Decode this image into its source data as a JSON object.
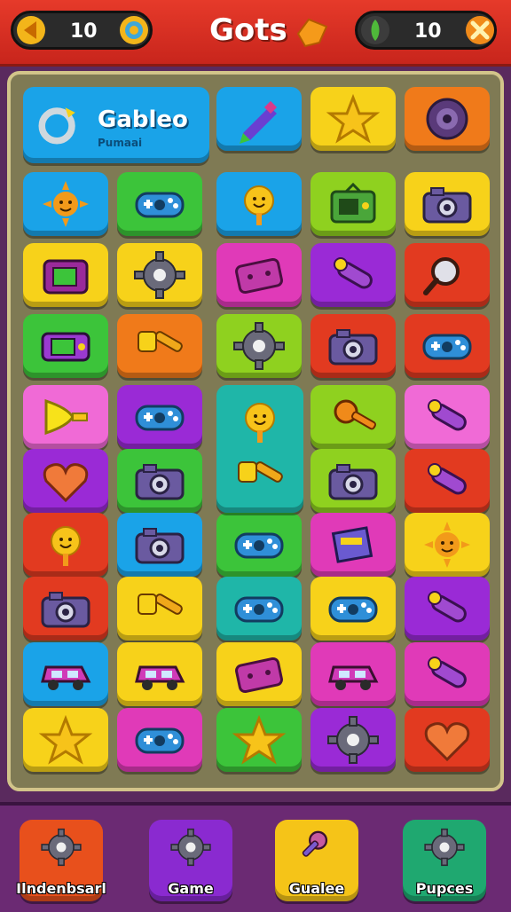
{
  "header": {
    "title": "Gots",
    "left_counter": "10",
    "right_counter": "10",
    "accent": "#e63a2a"
  },
  "banner": {
    "title": "Gableo",
    "subtitle": "Pumaai"
  },
  "colors": {
    "blue": "#1aa3e8",
    "yellow": "#f7d21a",
    "orange": "#f07a1a",
    "green": "#3cc43a",
    "lime": "#8fd11f",
    "pink": "#f06ad6",
    "purple": "#9a2ad6",
    "red": "#e23a20",
    "teal": "#1fb6a8",
    "magenta": "#e03ab8"
  },
  "tiles": [
    {
      "color": "blue",
      "icon": "pencil-icon"
    },
    {
      "color": "yellow",
      "icon": "star-icon"
    },
    {
      "color": "orange",
      "icon": "target-icon"
    },
    {
      "color": "blue",
      "icon": "sun-icon"
    },
    {
      "color": "green",
      "icon": "gamepad-icon"
    },
    {
      "color": "blue",
      "icon": "smiley-icon"
    },
    {
      "color": "lime",
      "icon": "tv-icon"
    },
    {
      "color": "yellow",
      "icon": "camera-icon"
    },
    {
      "color": "yellow",
      "icon": "radio-icon"
    },
    {
      "color": "yellow",
      "icon": "gear-icon"
    },
    {
      "color": "magenta",
      "icon": "handheld-icon"
    },
    {
      "color": "purple",
      "icon": "tube-icon"
    },
    {
      "color": "red",
      "icon": "magnifier-icon"
    },
    {
      "color": "green",
      "icon": "console-icon"
    },
    {
      "color": "orange",
      "icon": "hammer-icon"
    },
    {
      "color": "lime",
      "icon": "gear-icon"
    },
    {
      "color": "red",
      "icon": "camera-icon"
    },
    {
      "color": "red",
      "icon": "gamepad-icon"
    },
    {
      "color": "pink",
      "icon": "horn-icon"
    },
    {
      "color": "purple",
      "icon": "gamepad-icon"
    },
    {
      "color": "lime",
      "icon": "key-icon"
    },
    {
      "color": "pink",
      "icon": "tube-icon"
    },
    {
      "color": "purple",
      "icon": "heart-icon"
    },
    {
      "color": "green",
      "icon": "camera-icon"
    },
    {
      "color": "lime",
      "icon": "camera-icon"
    },
    {
      "color": "red",
      "icon": "tube-icon"
    },
    {
      "color": "red",
      "icon": "smiley-icon"
    },
    {
      "color": "blue",
      "icon": "camera-icon"
    },
    {
      "color": "green",
      "icon": "gamepad-icon"
    },
    {
      "color": "magenta",
      "icon": "box-icon"
    },
    {
      "color": "yellow",
      "icon": "sun-icon"
    },
    {
      "color": "red",
      "icon": "camera-icon"
    },
    {
      "color": "yellow",
      "icon": "hammer-icon"
    },
    {
      "color": "teal",
      "icon": "gamepad-icon"
    },
    {
      "color": "yellow",
      "icon": "gamepad-icon"
    },
    {
      "color": "purple",
      "icon": "tube-icon"
    },
    {
      "color": "blue",
      "icon": "car-icon"
    },
    {
      "color": "yellow",
      "icon": "car-icon"
    },
    {
      "color": "yellow",
      "icon": "handheld-icon"
    },
    {
      "color": "magenta",
      "icon": "car-icon"
    },
    {
      "color": "magenta",
      "icon": "tube-icon"
    },
    {
      "color": "yellow",
      "icon": "star-icon"
    },
    {
      "color": "magenta",
      "icon": "gamepad-icon"
    },
    {
      "color": "green",
      "icon": "star-icon"
    },
    {
      "color": "purple",
      "icon": "gear-icon"
    },
    {
      "color": "red",
      "icon": "heart-icon"
    }
  ],
  "tall_tile": {
    "color": "teal",
    "icons": [
      "smiley-icon",
      "hammer-icon"
    ]
  },
  "nav": [
    {
      "label": "Ilndenbsarl",
      "color": "#e8501c",
      "icon": "gear-icon"
    },
    {
      "label": "Game",
      "color": "#8a2ad0",
      "icon": "gear-icon"
    },
    {
      "label": "Gualee",
      "color": "#f5c418",
      "icon": "mic-icon"
    },
    {
      "label": "Pupces",
      "color": "#1fa870",
      "icon": "gear-icon"
    }
  ]
}
